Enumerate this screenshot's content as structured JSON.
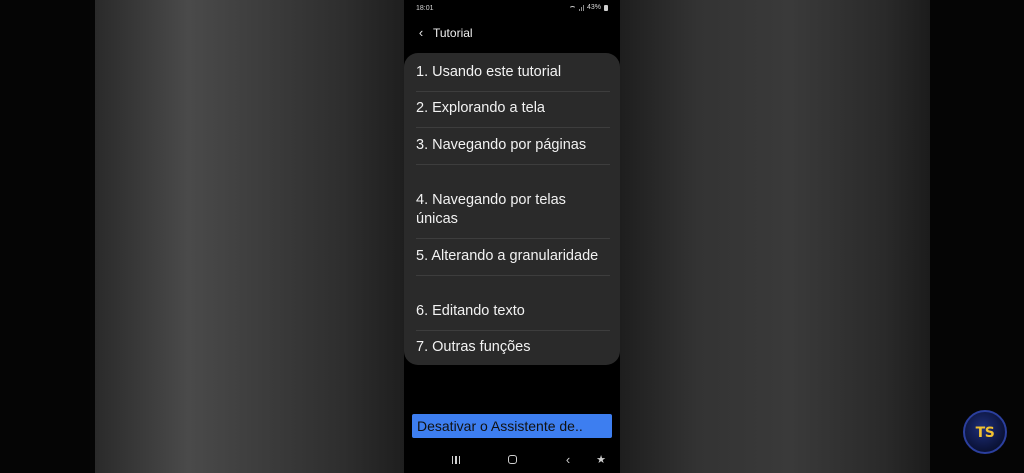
{
  "status_bar": {
    "time": "18:01",
    "battery": "43%"
  },
  "header": {
    "title": "Tutorial"
  },
  "menu": {
    "items": [
      {
        "label": "1. Usando este tutorial"
      },
      {
        "label": "2. Explorando a tela"
      },
      {
        "label": "3. Navegando por páginas"
      },
      {
        "label": "4. Navegando por telas únicas"
      },
      {
        "label": "5. Alterando a granularidade"
      },
      {
        "label": "6. Editando texto"
      },
      {
        "label": "7. Outras funções"
      }
    ]
  },
  "disable_button": {
    "label": "Desativar o Assistente de.."
  },
  "logo": {
    "text": "TS"
  },
  "colors": {
    "accent": "#3d7ef0",
    "card": "#2a2a2a",
    "logo_text": "#f2c230"
  },
  "icons": {
    "back": "back-arrow-icon",
    "nav": [
      "recents-icon",
      "home-icon",
      "back-icon",
      "accessibility-icon"
    ]
  }
}
